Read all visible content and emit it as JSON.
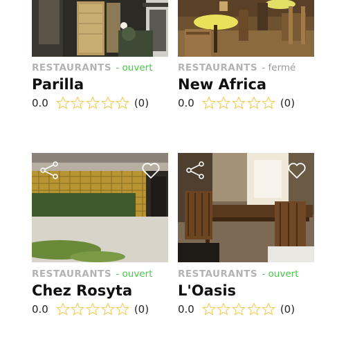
{
  "cards": [
    {
      "category": "RESTAURANTS",
      "status_text": "- ouvert",
      "status": "open",
      "name": "Parilla",
      "rating": "0.0",
      "stars_filled": 0,
      "stars_total": 5,
      "review_count": "(0)",
      "icons": [
        "share-icon",
        "heart-icon"
      ]
    },
    {
      "category": "RESTAURANTS",
      "status_text": "- fermé",
      "status": "closed",
      "name": "New Africa",
      "rating": "0.0",
      "stars_filled": 0,
      "stars_total": 5,
      "review_count": "(0)",
      "icons": [
        "share-icon",
        "heart-icon"
      ]
    },
    {
      "category": "RESTAURANTS",
      "status_text": "- ouvert",
      "status": "open",
      "name": "Chez Rosyta",
      "rating": "0.0",
      "stars_filled": 0,
      "stars_total": 5,
      "review_count": "(0)",
      "icons": [
        "share-icon",
        "heart-icon"
      ]
    },
    {
      "category": "RESTAURANTS",
      "status_text": "- ouvert",
      "status": "open",
      "name": "L'Oasis",
      "rating": "0.0",
      "stars_filled": 0,
      "stars_total": 5,
      "review_count": "(0)",
      "icons": [
        "share-icon",
        "heart-icon"
      ]
    }
  ],
  "colors": {
    "status_open": "#47c747",
    "status_closed": "#999999",
    "category": "#b3b3b3",
    "star_outline": "#f2c744"
  }
}
